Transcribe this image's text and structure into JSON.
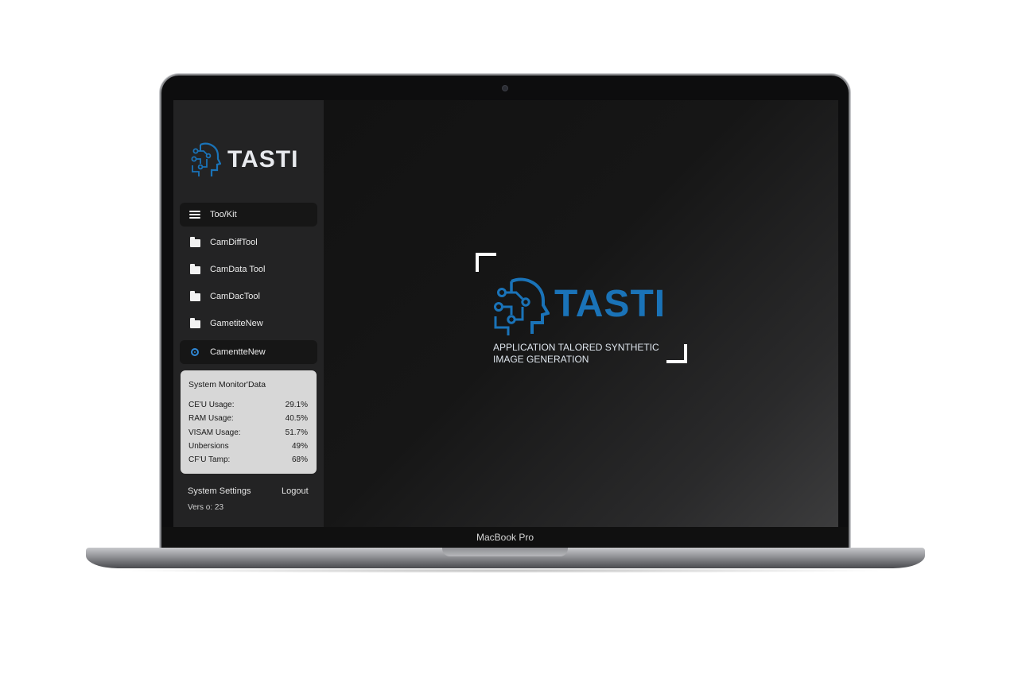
{
  "device": {
    "label": "MacBook Pro"
  },
  "sidebar": {
    "brand": "TASTI",
    "items": [
      {
        "label": "Too/Kit",
        "icon": "menu-icon",
        "active": true
      },
      {
        "label": "CamDiffTool",
        "icon": "folder-icon"
      },
      {
        "label": "CamData Tool",
        "icon": "folder-icon"
      },
      {
        "label": "CamDacTool",
        "icon": "folder-icon"
      },
      {
        "label": "GametiteNew",
        "icon": "folder-icon"
      },
      {
        "label": "CamentteNew",
        "icon": "circle-dot-icon",
        "active": true
      }
    ],
    "monitor": {
      "title": "System Monitor'Data",
      "rows": [
        {
          "label": "CE'U Usage:",
          "value": "29.1%"
        },
        {
          "label": "RAM Usage:",
          "value": "40.5%"
        },
        {
          "label": "VISAM Usage:",
          "value": "51.7%"
        },
        {
          "label": "Unbersions",
          "value": "49%"
        },
        {
          "label": "CF'U Tamp:",
          "value": "68%"
        }
      ]
    },
    "settings_label": "System Settings",
    "logout_label": "Logout",
    "version": "Vers o: 23"
  },
  "main": {
    "brand": "TASTI",
    "tagline_line1": "APPLICATION TALORED SYNTHETIC",
    "tagline_line2": "IMAGE GENERATION"
  },
  "colors": {
    "accent": "#1a73b8",
    "sidebar_bg": "#232324",
    "main_bg": "#121212",
    "monitor_bg": "#d7d7d7"
  }
}
